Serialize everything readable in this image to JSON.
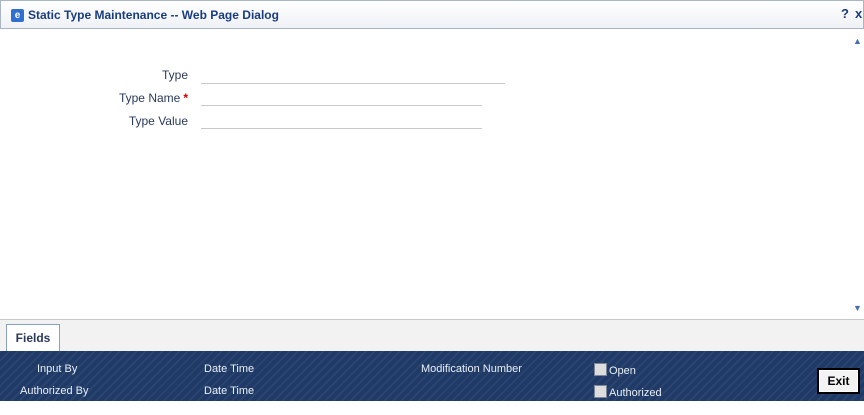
{
  "window": {
    "title": "Static Type Maintenance -- Web Page Dialog",
    "help": "?",
    "close": "x"
  },
  "form": {
    "type_label": "Type",
    "type_name_label": "Type Name",
    "required_mark": "*",
    "type_value_label": "Type Value",
    "type_value": "",
    "type_name_value": "",
    "type_value_value": ""
  },
  "tabs": [
    {
      "label": "Fields"
    }
  ],
  "footer": {
    "input_by": "Input By",
    "date_time_1": "Date Time",
    "modification_number": "Modification Number",
    "open_label": "Open",
    "authorized_by": "Authorized By",
    "date_time_2": "Date Time",
    "authorized_label": "Authorized",
    "exit_label": "Exit"
  }
}
